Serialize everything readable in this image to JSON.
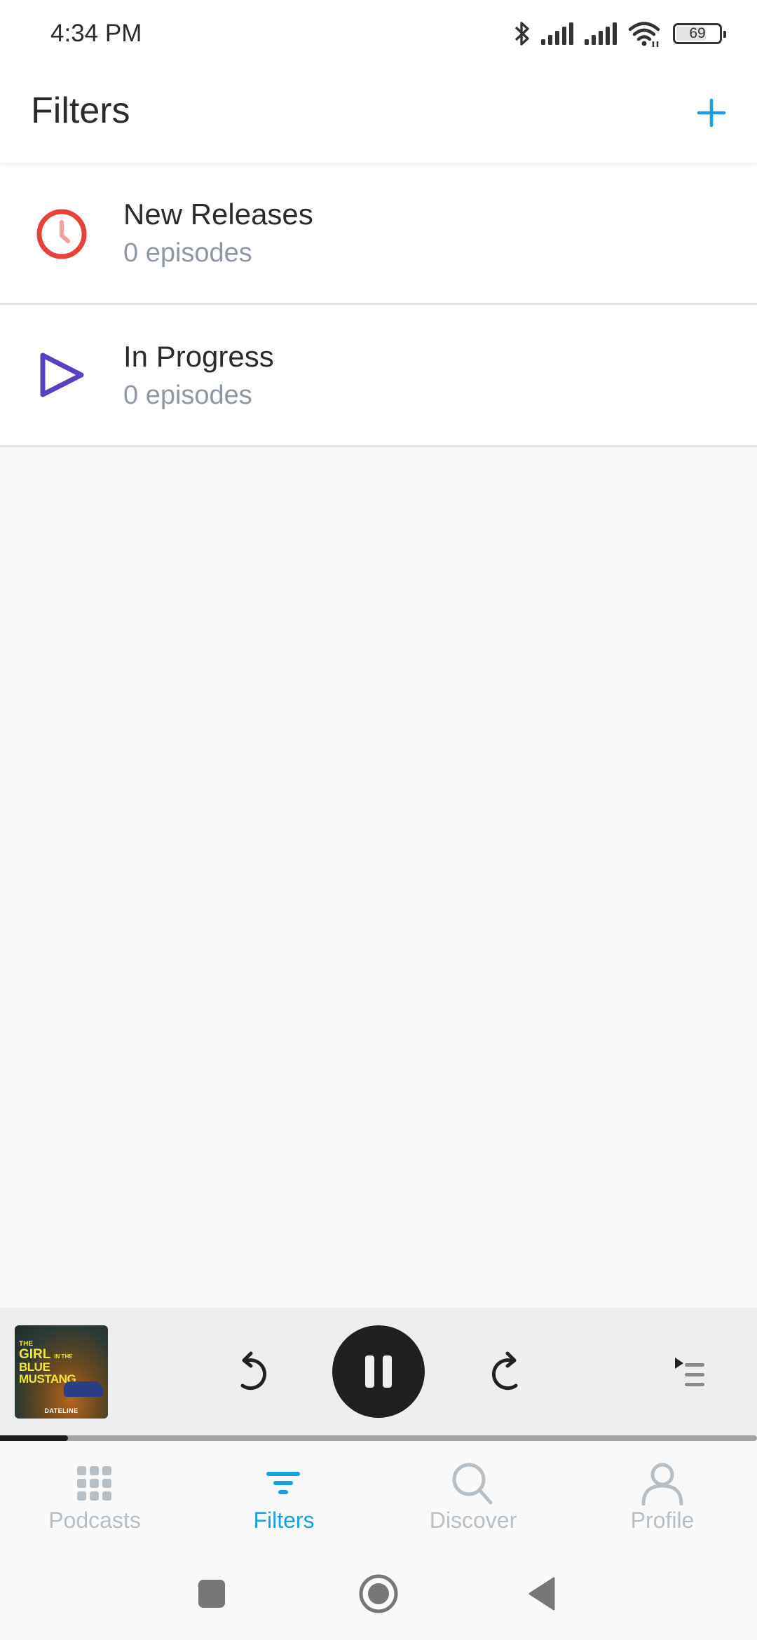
{
  "status_bar": {
    "time": "4:34 PM",
    "battery": "69",
    "icons": [
      "bluetooth-icon",
      "signal-icon",
      "signal-icon",
      "wifi-icon",
      "battery-icon"
    ]
  },
  "header": {
    "title": "Filters",
    "add_icon": "plus-icon",
    "accent_color": "#1aa0e0"
  },
  "filters": [
    {
      "name": "New Releases",
      "count": "0 episodes",
      "icon": "clock-icon",
      "color": "#e5413f"
    },
    {
      "name": "In Progress",
      "count": "0 episodes",
      "icon": "play-icon",
      "color": "#5a3fc0"
    }
  ],
  "mini_player": {
    "artwork": {
      "line1": "THE",
      "line2": "GIRL",
      "line2_small": "IN THE",
      "line3": "BLUE MUSTANG",
      "brand": "DATELINE"
    },
    "controls": [
      "skip-back-icon",
      "pause-icon",
      "skip-forward-icon",
      "up-next-icon"
    ],
    "progress_percent": 9
  },
  "bottom_nav": {
    "items": [
      {
        "label": "Podcasts",
        "icon": "grid-icon",
        "active": false
      },
      {
        "label": "Filters",
        "icon": "filter-icon",
        "active": true
      },
      {
        "label": "Discover",
        "icon": "search-icon",
        "active": false
      },
      {
        "label": "Profile",
        "icon": "profile-icon",
        "active": false
      }
    ]
  },
  "system_nav": [
    "recents-icon",
    "home-icon",
    "back-icon"
  ]
}
